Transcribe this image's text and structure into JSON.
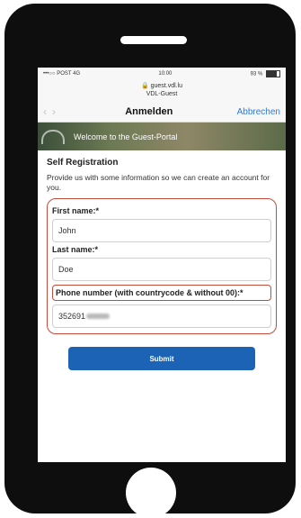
{
  "status": {
    "carrier": "•••○○ POST 4G",
    "time": "10:00",
    "battery": "93 %"
  },
  "browser": {
    "host": "guest.vdl.lu",
    "network": "VDL-Guest"
  },
  "nav": {
    "title": "Anmelden",
    "cancel": "Abbrechen"
  },
  "banner": {
    "text": "Welcome to the Guest-Portal"
  },
  "form": {
    "title": "Self Registration",
    "intro": "Provide us with some information so we can create an account for you.",
    "first_name_label": "First name:*",
    "first_name_value": "John",
    "last_name_label": "Last name:*",
    "last_name_value": "Doe",
    "phone_label": "Phone number (with countrycode & without 00):*",
    "phone_value": "352691",
    "submit": "Submit"
  },
  "colors": {
    "accent": "#1c63b5",
    "highlight": "#c84b3c"
  }
}
